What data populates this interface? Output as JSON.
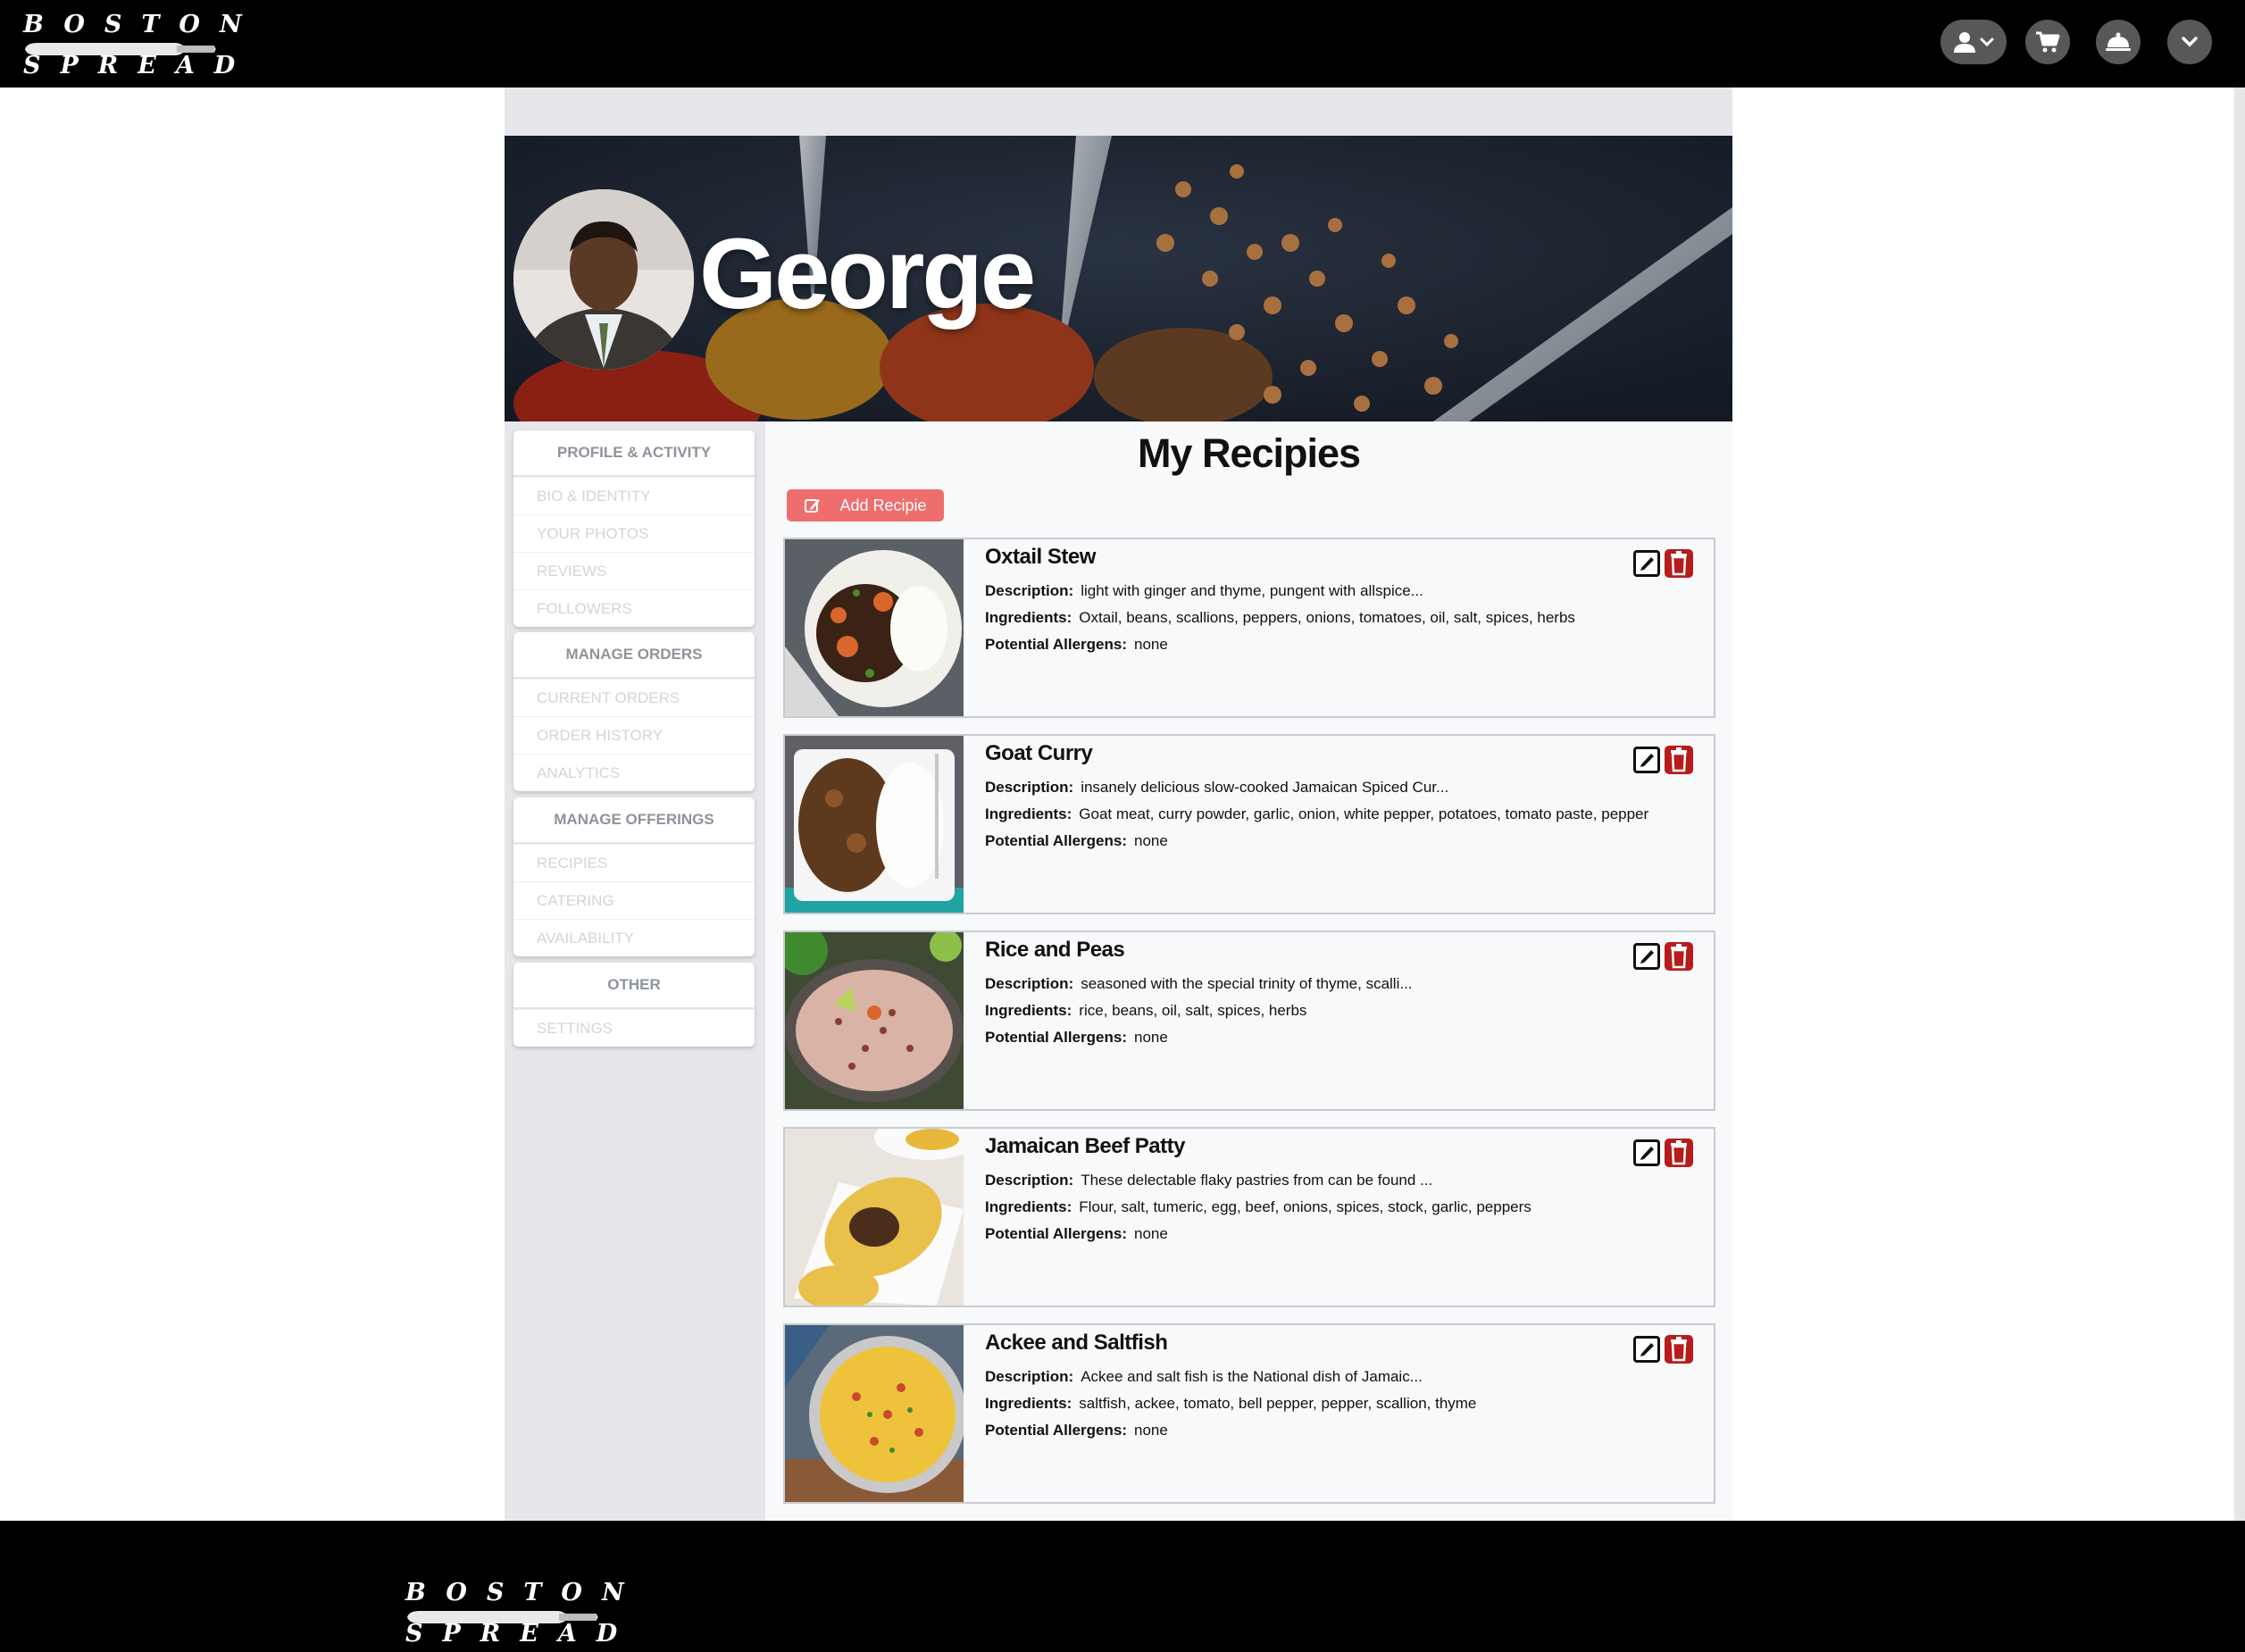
{
  "brand": {
    "line1": "BOSTON",
    "line2": "SPREAD"
  },
  "nav": {
    "account_icon": "user-icon",
    "cart_icon": "cart-icon",
    "service_icon": "service-bell-icon",
    "menu_icon": "chevron-down-icon"
  },
  "profile": {
    "name": "George"
  },
  "sidebar": {
    "sections": [
      {
        "title": "PROFILE & ACTIVITY",
        "items": [
          "BIO & IDENTITY",
          "YOUR PHOTOS",
          "REVIEWS",
          "FOLLOWERS"
        ]
      },
      {
        "title": "MANAGE ORDERS",
        "items": [
          "CURRENT ORDERS",
          "ORDER HISTORY",
          "ANALYTICS"
        ]
      },
      {
        "title": "MANAGE OFFERINGS",
        "items": [
          "RECIPIES",
          "CATERING",
          "AVAILABILITY"
        ]
      },
      {
        "title": "OTHER",
        "items": [
          "SETTINGS"
        ]
      }
    ]
  },
  "main": {
    "title": "My Recipies",
    "add_button": "Add Recipie",
    "labels": {
      "description": "Description:",
      "ingredients": "Ingredients:",
      "allergens": "Potential Allergens:"
    },
    "recipes": [
      {
        "name": "Oxtail Stew",
        "description": "light with ginger and thyme, pungent with allspice...",
        "ingredients": "Oxtail, beans, scallions, peppers, onions, tomatoes, oil, salt, spices, herbs",
        "allergens": "none"
      },
      {
        "name": "Goat Curry",
        "description": "insanely delicious slow-cooked Jamaican Spiced Cur...",
        "ingredients": "Goat meat, curry powder, garlic, onion, white pepper, potatoes, tomato paste, pepper",
        "allergens": "none"
      },
      {
        "name": "Rice and Peas",
        "description": "seasoned with the special trinity of thyme, scalli...",
        "ingredients": "rice, beans, oil, salt, spices, herbs",
        "allergens": "none"
      },
      {
        "name": "Jamaican Beef Patty",
        "description": "These delectable flaky pastries from can be found ...",
        "ingredients": "Flour, salt, tumeric, egg, beef, onions, spices, stock, garlic, peppers",
        "allergens": "none"
      },
      {
        "name": "Ackee and Saltfish",
        "description": "Ackee and salt fish is the National dish of Jamaic...",
        "ingredients": "saltfish, ackee, tomato, bell pepper, pepper, scallion, thyme",
        "allergens": "none"
      }
    ]
  },
  "colors": {
    "accent": "#ee6e6e",
    "delete": "#b71c1c",
    "header": "#000000"
  }
}
